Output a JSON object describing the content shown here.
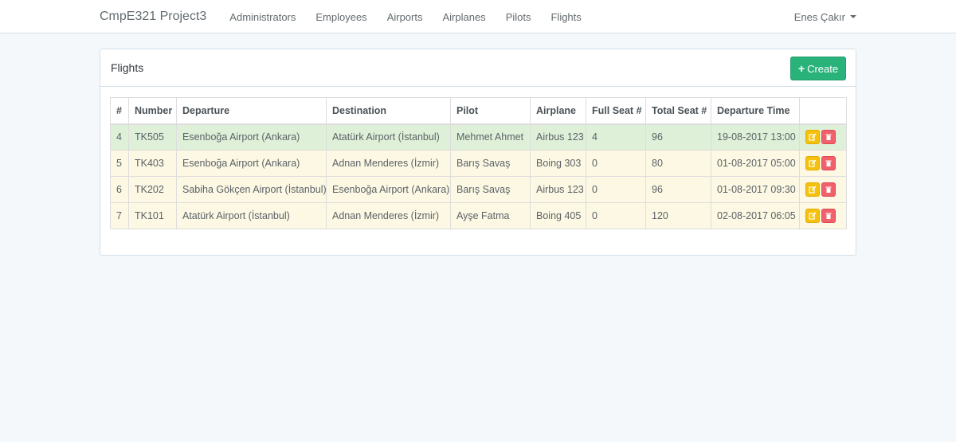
{
  "navbar": {
    "brand": "CmpE321 Project3",
    "links": [
      "Administrators",
      "Employees",
      "Airports",
      "Airplanes",
      "Pilots",
      "Flights"
    ],
    "user": "Enes Çakır"
  },
  "panel": {
    "title": "Flights",
    "create_label": "Create"
  },
  "table": {
    "headers": [
      "#",
      "Number",
      "Departure",
      "Destination",
      "Pilot",
      "Airplane",
      "Full Seat #",
      "Total Seat #",
      "Departure Time",
      ""
    ],
    "rows": [
      {
        "id": "4",
        "number": "TK505",
        "departure": "Esenboğa Airport (Ankara)",
        "destination": "Atatürk Airport (İstanbul)",
        "pilot": "Mehmet Ahmet",
        "airplane": "Airbus 123",
        "full_seat": "4",
        "total_seat": "96",
        "departure_time": "19-08-2017 13:00",
        "status": "success"
      },
      {
        "id": "5",
        "number": "TK403",
        "departure": "Esenboğa Airport (Ankara)",
        "destination": "Adnan Menderes (İzmir)",
        "pilot": "Barış Savaş",
        "airplane": "Boing 303",
        "full_seat": "0",
        "total_seat": "80",
        "departure_time": "01-08-2017 05:00",
        "status": "warning"
      },
      {
        "id": "6",
        "number": "TK202",
        "departure": "Sabiha Gökçen Airport (İstanbul)",
        "destination": "Esenboğa Airport (Ankara)",
        "pilot": "Barış Savaş",
        "airplane": "Airbus 123",
        "full_seat": "0",
        "total_seat": "96",
        "departure_time": "01-08-2017 09:30",
        "status": "warning"
      },
      {
        "id": "7",
        "number": "TK101",
        "departure": "Atatürk Airport (İstanbul)",
        "destination": "Adnan Menderes (İzmir)",
        "pilot": "Ayşe Fatma",
        "airplane": "Boing 405",
        "full_seat": "0",
        "total_seat": "120",
        "departure_time": "02-08-2017 06:05",
        "status": "warning"
      }
    ]
  },
  "colors": {
    "create_button": "#2ab27b",
    "edit_button": "#f5c10d",
    "delete_button": "#f0616b",
    "row_success": "#dff0d8",
    "row_warning": "#fcf8e3"
  },
  "icons": {
    "create": "plus-icon",
    "edit": "edit-icon",
    "delete": "trash-icon",
    "user_menu": "caret-down-icon"
  }
}
